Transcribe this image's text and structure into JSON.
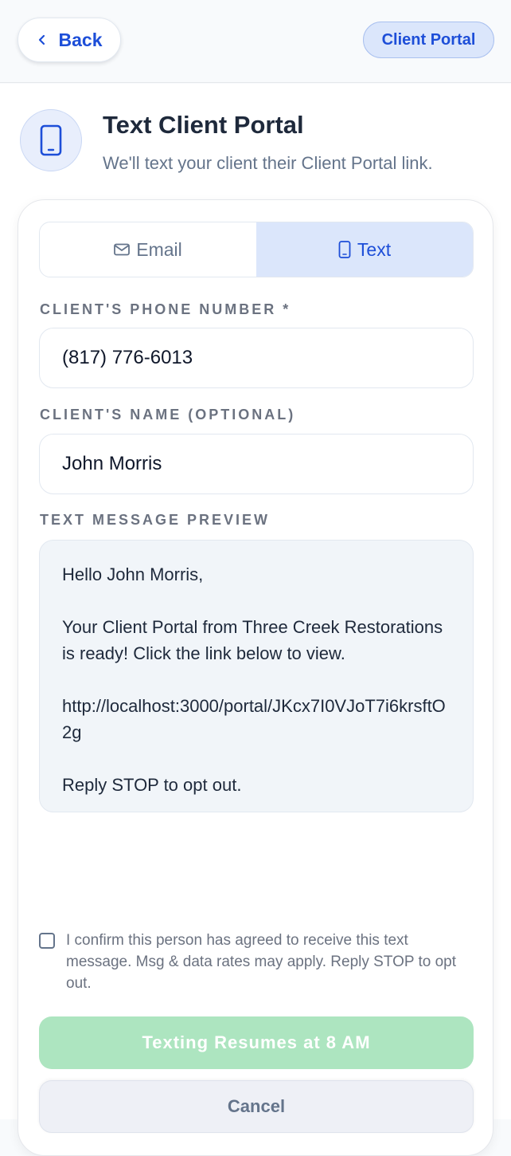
{
  "topbar": {
    "back_label": "Back",
    "portal_label": "Client Portal"
  },
  "header": {
    "title": "Text Client Portal",
    "subtitle": "We'll text your client their Client Portal link.",
    "icon": "phone-icon"
  },
  "tabs": [
    {
      "label": "Email",
      "icon": "mail-icon",
      "active": false
    },
    {
      "label": "Text",
      "icon": "phone-icon",
      "active": true
    }
  ],
  "form": {
    "phone_label": "CLIENT'S PHONE NUMBER *",
    "phone_value": "(817) 776-6013",
    "name_label": "CLIENT'S NAME (OPTIONAL)",
    "name_value": "John Morris",
    "preview_label": "TEXT MESSAGE PREVIEW"
  },
  "preview": {
    "greeting": "Hello John Morris,",
    "body": "Your Client Portal from Three Creek Restorations is ready! Click the link below to view.",
    "link": "http://localhost:3000/portal/JKcx7I0VJoT7i6krsftO2g",
    "footer": "Reply STOP to opt out."
  },
  "consent": {
    "checked": false,
    "text": "I confirm this person has agreed to receive this text message. Msg & data rates may apply. Reply STOP to opt out."
  },
  "actions": {
    "primary_label": "Texting Resumes at 8 AM",
    "cancel_label": "Cancel"
  },
  "colors": {
    "accent": "#1d4ed8",
    "active_tab_bg": "#dbe6fb",
    "disabled_primary": "#ade5c0"
  }
}
